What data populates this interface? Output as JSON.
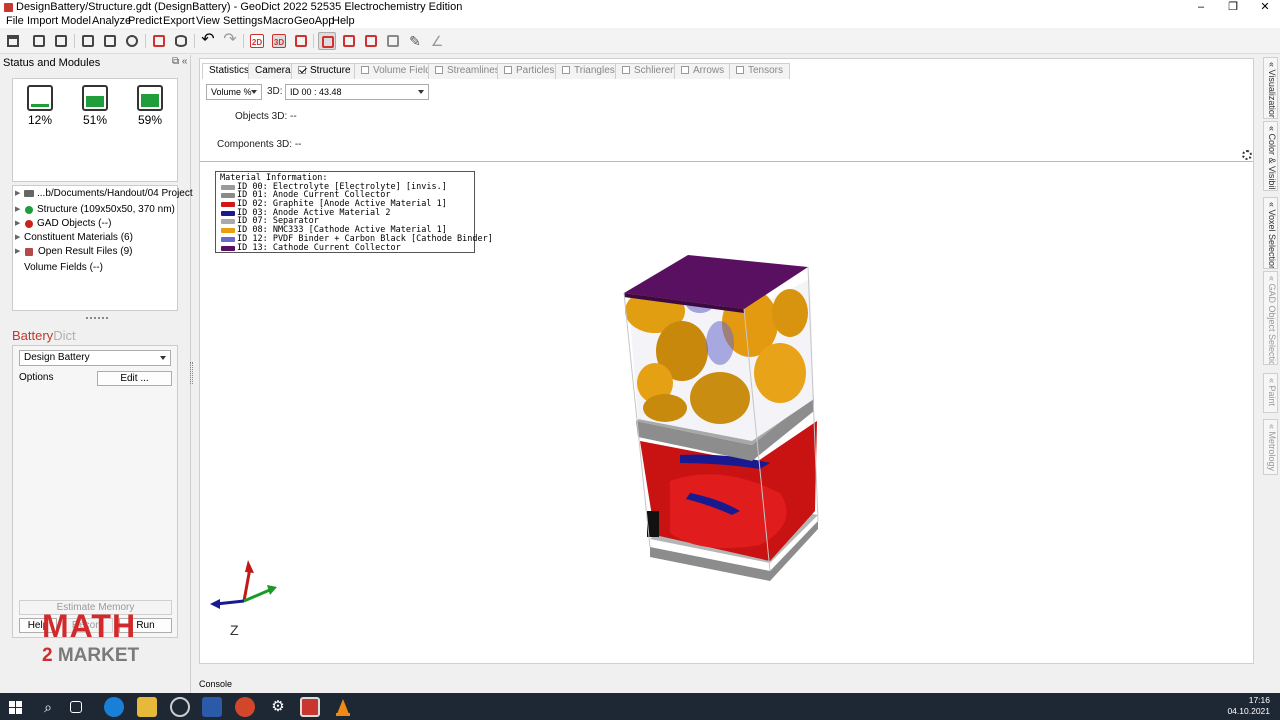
{
  "window": {
    "title": "DesignBattery/Structure.gdt (DesignBattery) - GeoDict 2022 52535 Electrochemistry Edition",
    "minimize": "–",
    "restore": "❐",
    "close": "✕"
  },
  "menu": [
    "File",
    "Import",
    "Model",
    "Analyze",
    "Predict",
    "Export",
    "View",
    "Settings",
    "Macro",
    "GeoApp",
    "Help"
  ],
  "toolbar": {
    "btn_2d": "2D",
    "btn_3d": "3D"
  },
  "left": {
    "title": "Status and Modules",
    "ctrls": "⧉ «",
    "modules": [
      {
        "pct": "12%",
        "fill": 0.12
      },
      {
        "pct": "51%",
        "fill": 0.51
      },
      {
        "pct": "59%",
        "fill": 0.59
      }
    ],
    "tree": [
      {
        "label": "...b/Documents/Handout/04 Project",
        "icon": "folder-icon"
      },
      {
        "label": "Structure (109x50x50, 370 nm)",
        "icon": "green-dot"
      },
      {
        "label": "GAD Objects (--)",
        "icon": "red-dot"
      },
      {
        "label": "Constituent Materials (6)",
        "icon": "none"
      },
      {
        "label": "Open Result Files (9)",
        "icon": "file-icon"
      },
      {
        "label": "Volume Fields (--)",
        "icon": "none"
      }
    ],
    "brand_a": "Battery",
    "brand_b": "Dict",
    "design_select": "Design Battery",
    "options_label": "Options",
    "edit_button": "Edit ...",
    "estimate_button": "Estimate Memory",
    "help_button": "Help",
    "record_button": "Record",
    "run_button": "Run",
    "logo_top": "MATH",
    "logo_num": "2",
    "logo_bottom": "MARKET"
  },
  "tabs": [
    {
      "label": "Statistics",
      "checkbox": false,
      "active": true
    },
    {
      "label": "Camera",
      "checkbox": false,
      "active": false
    },
    {
      "label": "Structure",
      "checkbox": true,
      "checked": true
    },
    {
      "label": "Volume Field",
      "checkbox": true,
      "checked": false
    },
    {
      "label": "Streamlines",
      "checkbox": true,
      "checked": false
    },
    {
      "label": "Particles",
      "checkbox": true,
      "checked": false
    },
    {
      "label": "Triangles",
      "checkbox": true,
      "checked": false
    },
    {
      "label": "Schlieren",
      "checkbox": true,
      "checked": false
    },
    {
      "label": "Arrows",
      "checkbox": true,
      "checked": false
    },
    {
      "label": "Tensors",
      "checkbox": true,
      "checked": false
    }
  ],
  "stats": {
    "mode_select": "Volume %",
    "dim_label": "3D:",
    "id_select": "ID 00 : 43.48",
    "objects_label": "Objects 3D:",
    "objects_value": "--",
    "components_label": "Components 3D:",
    "components_value": "--"
  },
  "materials": {
    "header": "Material Information:",
    "items": [
      {
        "text": "ID 00: Electrolyte [Electrolyte] [invis.]",
        "color": "#9a9a9a"
      },
      {
        "text": "ID 01: Anode Current Collector",
        "color": "#8a8a8a"
      },
      {
        "text": "ID 02: Graphite [Anode Active Material 1]",
        "color": "#d01818"
      },
      {
        "text": "ID 03: Anode Active Material 2",
        "color": "#1a1a90"
      },
      {
        "text": "ID 07: Separator",
        "color": "#a9a9a9"
      },
      {
        "text": "ID 08: NMC333 [Cathode Active Material 1]",
        "color": "#e8a010"
      },
      {
        "text": "ID 12: PVDF Binder + Carbon Black [Cathode Binder]",
        "color": "#6a6acc"
      },
      {
        "text": "ID 13: Cathode Current Collector",
        "color": "#5a1060"
      }
    ]
  },
  "rightstrip": [
    {
      "label": "« Visualization",
      "dim": false
    },
    {
      "label": "« Color & Visibility",
      "dim": false
    },
    {
      "label": "« Voxel Selection",
      "dim": false
    },
    {
      "label": "« GAD Object Selection",
      "dim": true
    },
    {
      "label": "« Paint",
      "dim": true
    },
    {
      "label": "« Metrology",
      "dim": true
    }
  ],
  "console": "Console",
  "clock": {
    "time": "17:16",
    "date": "04.10.2021"
  },
  "colors": {
    "accent": "#c0392b",
    "cathode_cc": "#5a1060",
    "nmc": "#e39a10",
    "graphite": "#d01818",
    "separator": "#a0a0a0"
  }
}
